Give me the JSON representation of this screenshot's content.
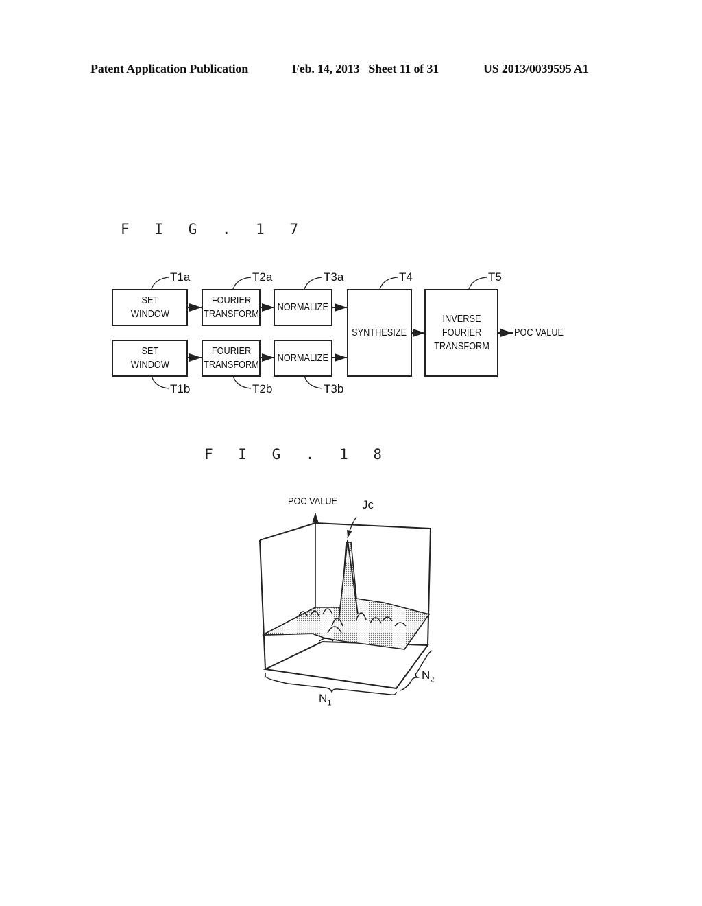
{
  "header": {
    "publication": "Patent Application Publication",
    "date_sheet": "Feb. 14, 2013   Sheet 11 of 31",
    "patent_number": "US 2013/0039595 A1"
  },
  "fig17": {
    "title": "F I G . 1 7",
    "blocks": {
      "t1a": {
        "ref": "T1a",
        "label": "SET\nWINDOW"
      },
      "t2a": {
        "ref": "T2a",
        "label": "FOURIER\nTRANSFORM"
      },
      "t3a": {
        "ref": "T3a",
        "label": "NORMALIZE"
      },
      "t1b": {
        "ref": "T1b",
        "label": "SET\nWINDOW"
      },
      "t2b": {
        "ref": "T2b",
        "label": "FOURIER\nTRANSFORM"
      },
      "t3b": {
        "ref": "T3b",
        "label": "NORMALIZE"
      },
      "t4": {
        "ref": "T4",
        "label": "SYNTHESIZE"
      },
      "t5": {
        "ref": "T5",
        "label": "INVERSE\nFOURIER\nTRANSFORM"
      }
    },
    "output_label": "POC VALUE"
  },
  "fig18": {
    "title": "F I G . 1 8",
    "axis_label": "POC VALUE",
    "peak_label": "Jc",
    "n1_label": "N",
    "n1_sub": "1",
    "n2_label": "N",
    "n2_sub": "2"
  }
}
